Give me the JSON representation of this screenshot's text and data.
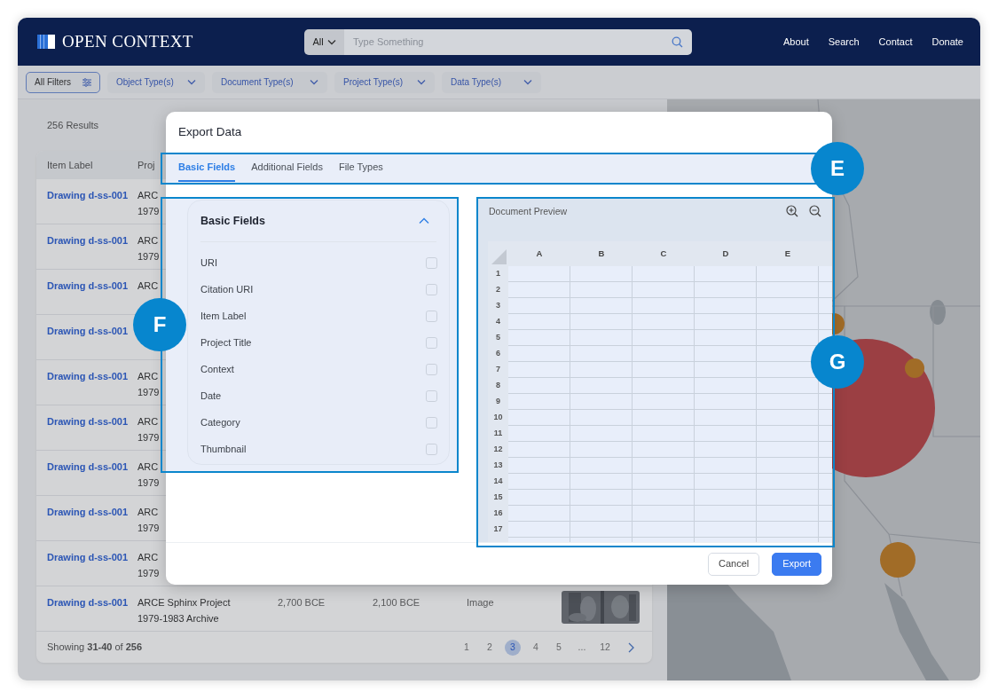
{
  "header": {
    "logo_text": "OPEN CONTEXT",
    "search": {
      "scope": "All",
      "placeholder": "Type Something"
    },
    "nav": [
      "About",
      "Search",
      "Contact",
      "Donate"
    ]
  },
  "filters": [
    {
      "label": "All Filters",
      "kind": "all"
    },
    {
      "label": "Object Type(s)",
      "kind": "dropdown"
    },
    {
      "label": "Document Type(s)",
      "kind": "dropdown"
    },
    {
      "label": "Project Type(s)",
      "kind": "dropdown"
    },
    {
      "label": "Data Type(s)",
      "kind": "dropdown"
    }
  ],
  "results": {
    "count": "256 Results",
    "columns": [
      "Item Label",
      "Proj"
    ],
    "rows": [
      {
        "label": "Drawing d-ss-001",
        "project": [
          "ARC",
          "1979"
        ]
      },
      {
        "label": "Drawing d-ss-001",
        "project": [
          "ARC",
          "1979"
        ]
      },
      {
        "label": "Drawing d-ss-001",
        "project": [
          "ARC"
        ]
      },
      {
        "label": "Drawing d-ss-001"
      },
      {
        "label": "Drawing d-ss-001",
        "project": [
          "ARC",
          "1979"
        ]
      },
      {
        "label": "Drawing d-ss-001",
        "project": [
          "ARC",
          "1979"
        ]
      },
      {
        "label": "Drawing d-ss-001",
        "project": [
          "ARC",
          "1979"
        ]
      },
      {
        "label": "Drawing d-ss-001",
        "project": [
          "ARC",
          "1979"
        ]
      },
      {
        "label": "Drawing d-ss-001",
        "project": [
          "ARC",
          "1979"
        ]
      },
      {
        "label": "Drawing d-ss-001",
        "project": [
          "ARCE Sphinx Project",
          "1979-1983 Archive"
        ],
        "start": "2,700 BCE",
        "end": "2,100 BCE",
        "type": "Image",
        "thumbnail": {
          "kind": "picture"
        }
      }
    ],
    "summary": "Showing **31-40** of **256**",
    "pages": [
      {
        "label": "1",
        "selected": false
      },
      {
        "label": "2",
        "selected": false
      },
      {
        "label": "3",
        "selected": true
      },
      {
        "label": "4",
        "selected": false
      },
      {
        "label": "5",
        "selected": false
      },
      {
        "label": "...",
        "selected": false
      },
      {
        "label": "12",
        "selected": false
      }
    ]
  },
  "map": {
    "kind": "picture"
  },
  "modal": {
    "title": "Export Data",
    "tabs": [
      {
        "label": "Basic Fields",
        "selected": true
      },
      {
        "label": "Additional Fields",
        "selected": false
      },
      {
        "label": "File Types",
        "selected": false
      }
    ],
    "fields_panel": {
      "title": "Basic Fields",
      "expanded": true,
      "fields": [
        {
          "label": "URI",
          "checked": false
        },
        {
          "label": "Citation URI",
          "checked": false
        },
        {
          "label": "Item Label",
          "checked": false
        },
        {
          "label": "Project Title",
          "checked": false
        },
        {
          "label": "Context",
          "checked": false
        },
        {
          "label": "Date",
          "checked": false
        },
        {
          "label": "Category",
          "checked": false
        },
        {
          "label": "Thumbnail",
          "checked": false
        }
      ]
    },
    "preview": {
      "title": "Document Preview",
      "columns": [
        "A",
        "B",
        "C",
        "D",
        "E"
      ],
      "rows": [
        "1",
        "2",
        "3",
        "4",
        "5",
        "6",
        "7",
        "8",
        "9",
        "10",
        "11",
        "12",
        "13",
        "14",
        "15",
        "16",
        "17"
      ]
    },
    "buttons": [
      {
        "label": "Cancel",
        "kind": "secondary"
      },
      {
        "label": "Export",
        "kind": "primary"
      }
    ]
  },
  "callouts": [
    {
      "label": "E"
    },
    {
      "label": "F"
    },
    {
      "label": "G"
    }
  ]
}
